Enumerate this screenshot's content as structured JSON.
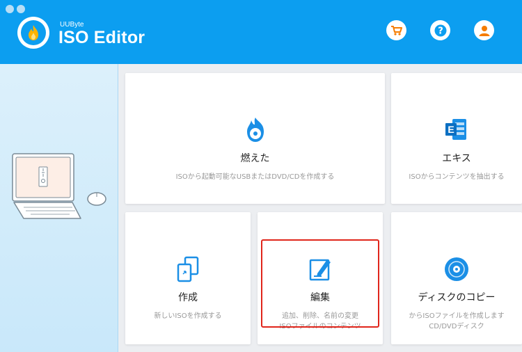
{
  "app": {
    "brand_small": "UUByte",
    "brand_big": "ISO Editor"
  },
  "header": {
    "buttons": [
      {
        "name": "cart-icon",
        "color": "#f57c00"
      },
      {
        "name": "help-icon",
        "color": "#0c9ef0"
      },
      {
        "name": "user-icon",
        "color": "#f57c00"
      }
    ]
  },
  "cards": {
    "burn": {
      "icon": "flame-disc-icon",
      "title": "燃えた",
      "desc": "ISOから起動可能なUSBまたはDVD/CDを作成する"
    },
    "extract": {
      "icon": "exchange-icon",
      "title": "エキス",
      "desc": "ISOからコンテンツを抽出する"
    },
    "create": {
      "icon": "copy-files-icon",
      "title": "作成",
      "desc": "新しいISOを作成する"
    },
    "edit": {
      "icon": "edit-icon",
      "title": "編集",
      "desc": "追加、削除、名前の変更",
      "desc2": "ISOファイルのコンテンツ"
    },
    "copy": {
      "icon": "disc-icon",
      "title": "ディスクのコピー",
      "desc": "からISOファイルを作成します",
      "desc2": "CD/DVDディスク"
    }
  },
  "colors": {
    "accent": "#0c9ef0",
    "highlight": "#e0251b"
  }
}
